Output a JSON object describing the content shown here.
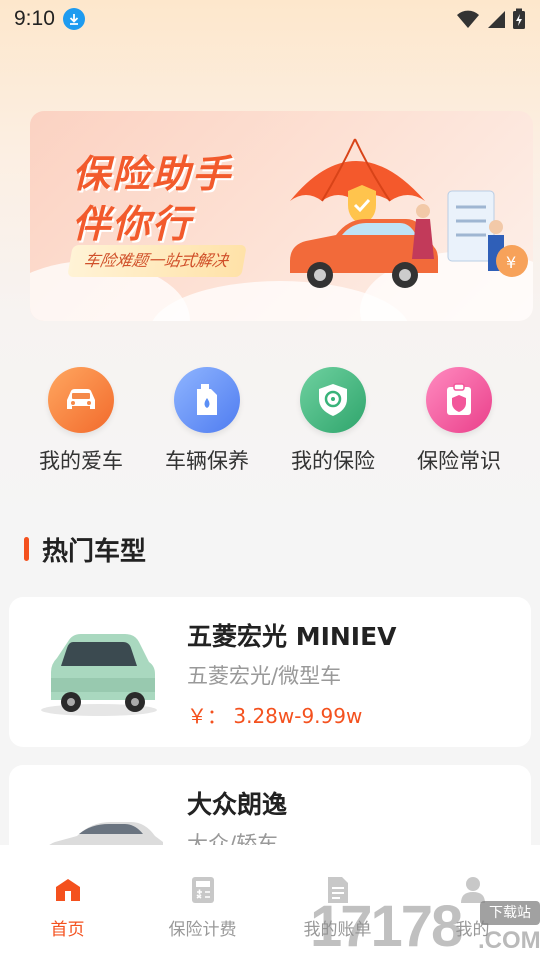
{
  "statusbar": {
    "time": "9:10"
  },
  "banner": {
    "title_line1": "保险助手",
    "title_line2": "伴你行",
    "tagline": "车险难题一站式解决"
  },
  "quick_actions": [
    {
      "label": "我的爱车",
      "icon": "car-icon",
      "color": "#f4802f"
    },
    {
      "label": "车辆保养",
      "icon": "oil-can-icon",
      "color": "#5b8ff5"
    },
    {
      "label": "我的保险",
      "icon": "shield-steering-icon",
      "color": "#39b37a"
    },
    {
      "label": "保险常识",
      "icon": "clipboard-shield-icon",
      "color": "#f2569a"
    }
  ],
  "section": {
    "title": "热门车型"
  },
  "cars": [
    {
      "name": "五菱宏光 MINIEV",
      "sub": "五菱宏光/微型车",
      "price": "￥： 3.28w-9.99w"
    },
    {
      "name": "大众朗逸",
      "sub": "大众/轿车",
      "price": ""
    }
  ],
  "tabbar": {
    "tabs": [
      {
        "label": "首页",
        "icon": "home-icon",
        "active": true
      },
      {
        "label": "保险计费",
        "icon": "calculator-icon",
        "active": false
      },
      {
        "label": "我的账单",
        "icon": "bill-icon",
        "active": false
      },
      {
        "label": "我的",
        "icon": "user-icon",
        "active": false
      }
    ]
  },
  "watermark": {
    "number": "17178",
    "domain": ".COM",
    "tag": "下载站"
  },
  "colors": {
    "accent": "#f4511e",
    "muted": "#999999"
  }
}
